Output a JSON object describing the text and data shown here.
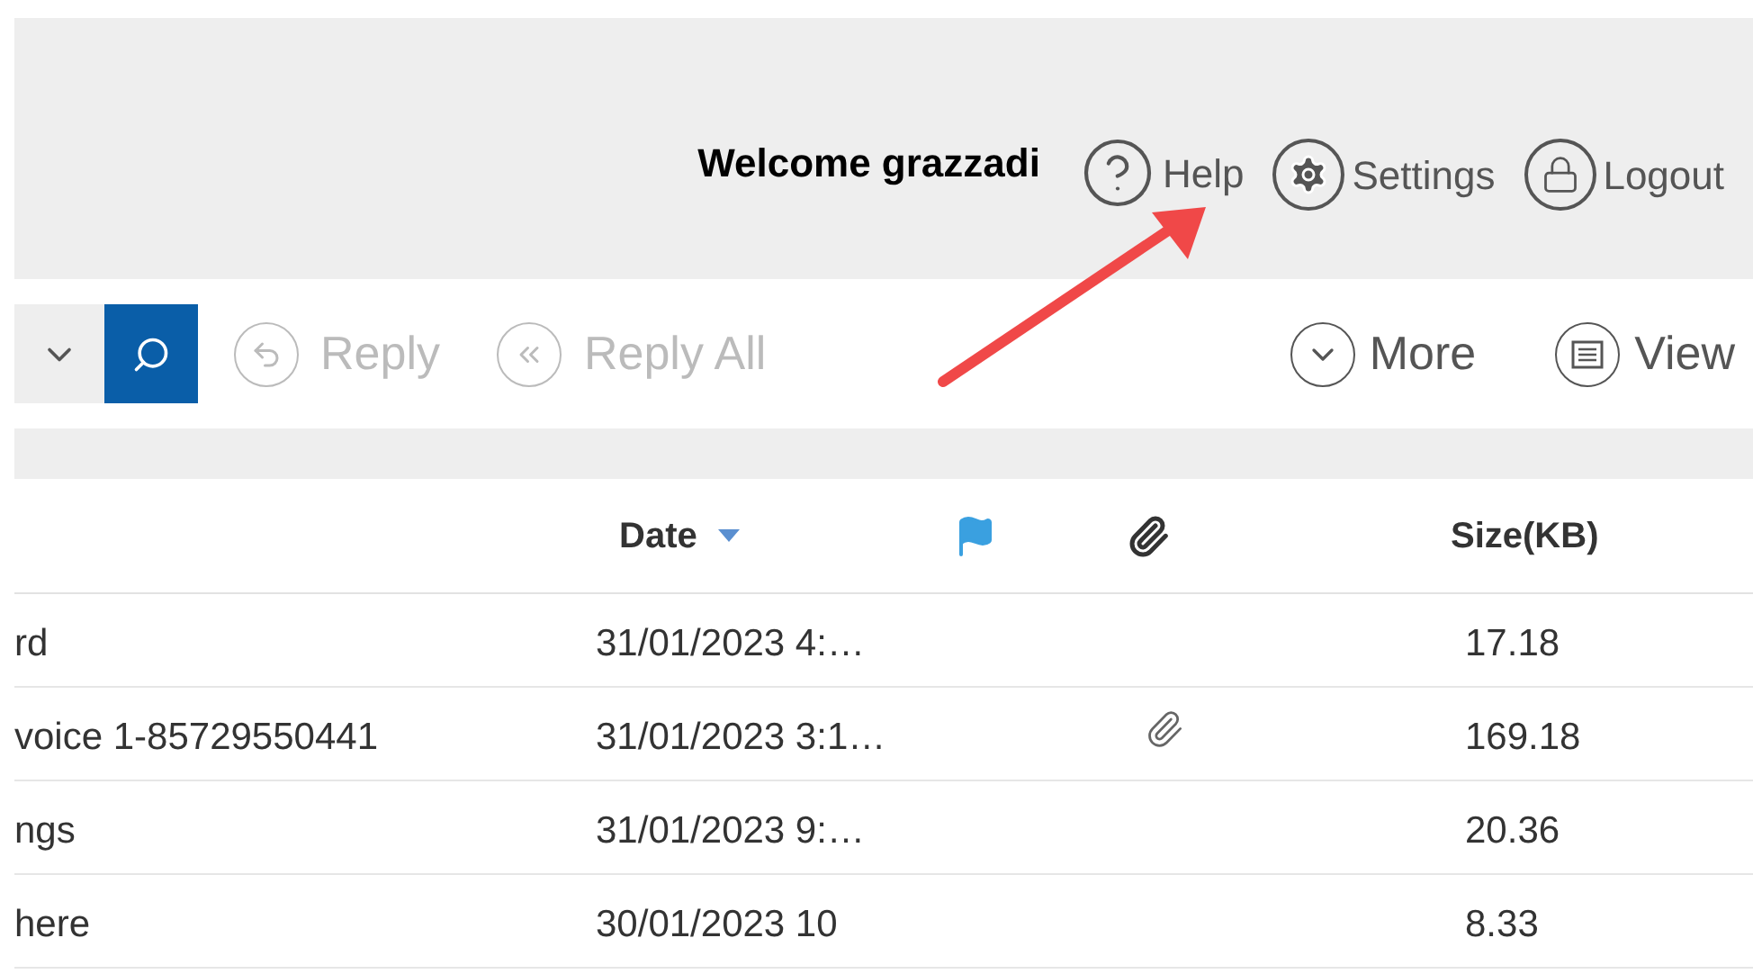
{
  "header": {
    "welcome": "Welcome grazzadi",
    "links": [
      {
        "kind": "help",
        "label": "Help"
      },
      {
        "kind": "settings",
        "label": "Settings"
      },
      {
        "kind": "logout",
        "label": "Logout"
      }
    ]
  },
  "toolbar": {
    "left": [
      {
        "kind": "reply",
        "label": "Reply",
        "disabled": true
      },
      {
        "kind": "reply-all",
        "label": "Reply All",
        "disabled": true
      }
    ],
    "right": [
      {
        "kind": "more",
        "label": "More"
      },
      {
        "kind": "view",
        "label": "View"
      }
    ]
  },
  "table": {
    "columns": [
      {
        "kind": "subject"
      },
      {
        "kind": "date",
        "label": "Date",
        "sorted": true
      },
      {
        "kind": "flag"
      },
      {
        "kind": "attachment"
      },
      {
        "kind": "size",
        "label": "Size(KB)"
      }
    ],
    "rows": [
      {
        "subject": "rd",
        "date": "31/01/2023 4:…",
        "attachment": false,
        "size": "17.18"
      },
      {
        "subject": "voice 1-85729550441",
        "date": "31/01/2023 3:1…",
        "attachment": true,
        "size": "169.18"
      },
      {
        "subject": "ngs",
        "date": "31/01/2023 9:…",
        "attachment": false,
        "size": "20.36"
      },
      {
        "subject": "here",
        "date": "30/01/2023 10",
        "attachment": false,
        "size": "8.33"
      }
    ]
  }
}
